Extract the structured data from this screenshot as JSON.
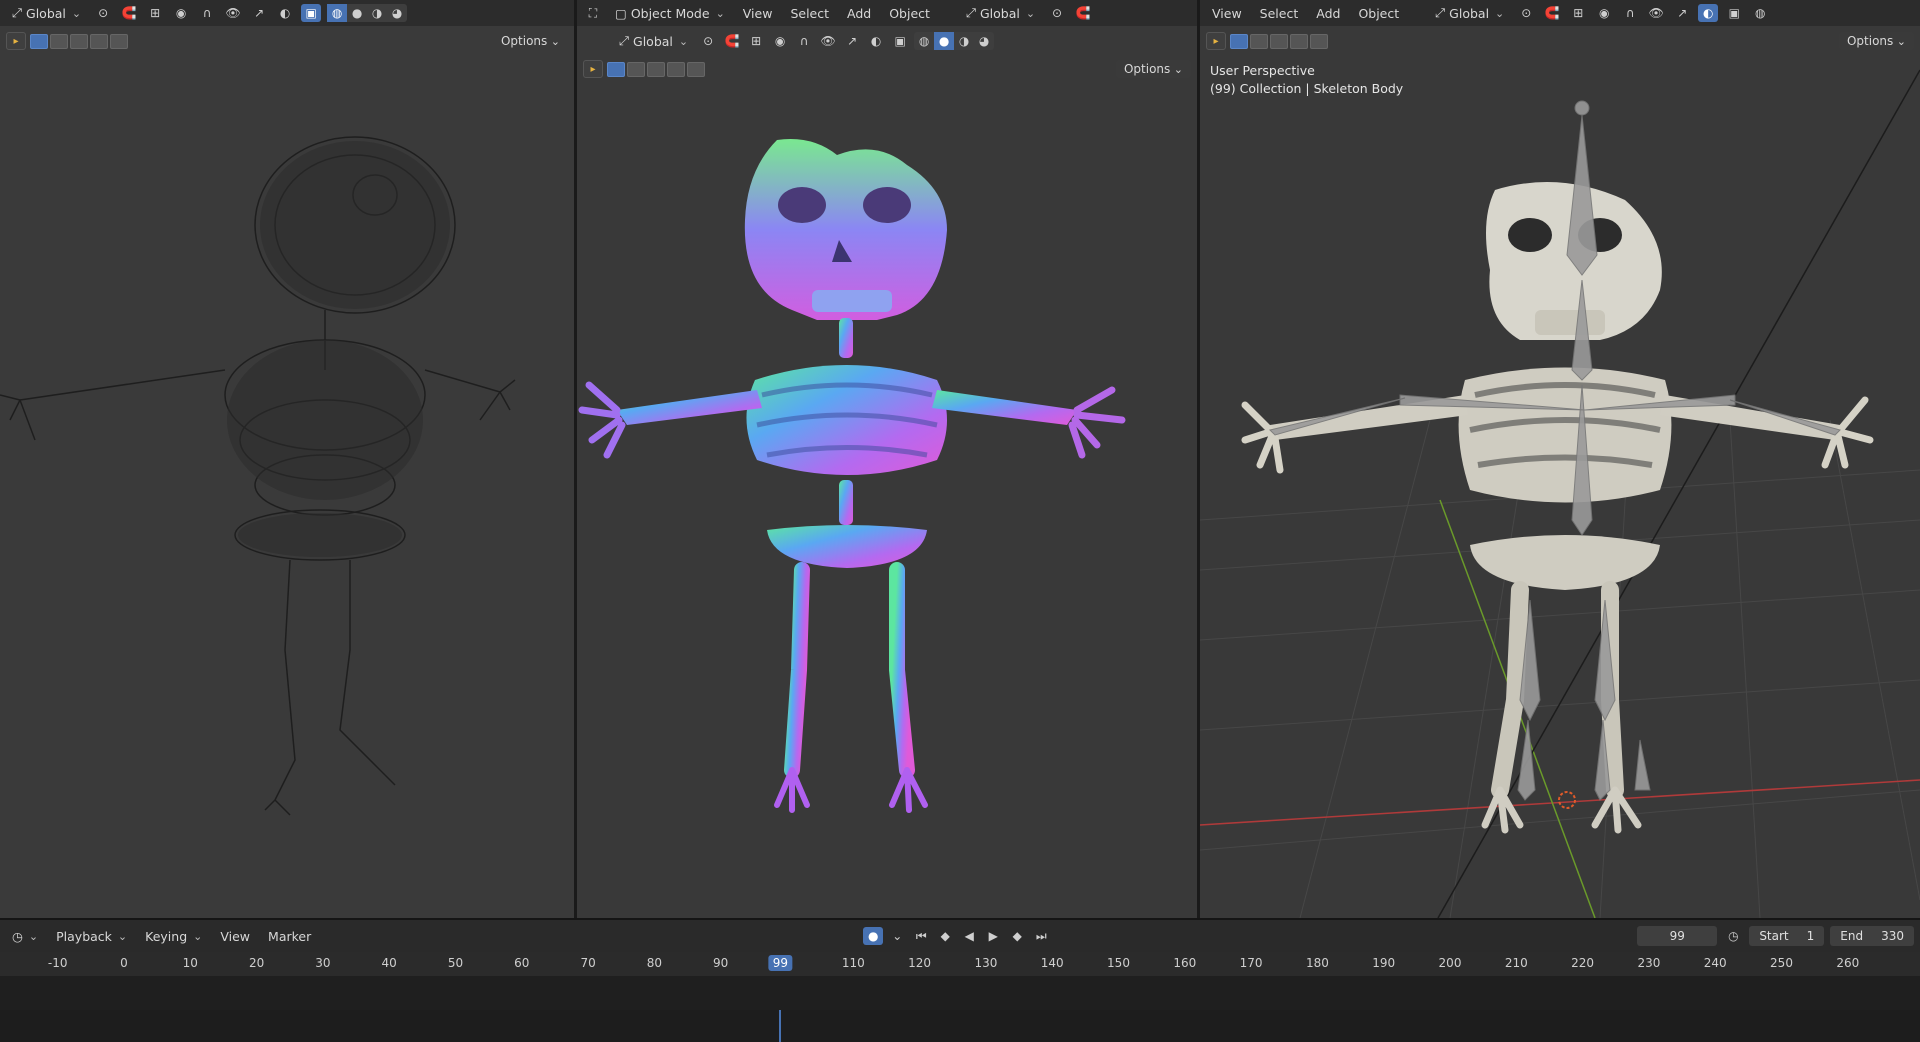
{
  "viewport_left": {
    "header": {
      "orientation": "Global",
      "options": "Options"
    }
  },
  "viewport_mid": {
    "header": {
      "mode": "Object Mode",
      "menu": [
        "View",
        "Select",
        "Add",
        "Object"
      ],
      "orientation": "Global"
    },
    "subheader": {
      "orientation": "Global",
      "options": "Options"
    }
  },
  "viewport_right": {
    "header": {
      "menu": [
        "View",
        "Select",
        "Add",
        "Object"
      ],
      "orientation": "Global",
      "options": "Options"
    },
    "overlay": {
      "perspective": "User Perspective",
      "collection": "(99) Collection | Skeleton Body"
    }
  },
  "timeline": {
    "menu": [
      "Playback",
      "Keying",
      "View",
      "Marker"
    ],
    "current_frame": "99",
    "start_label": "Start",
    "start_value": "1",
    "end_label": "End",
    "end_value": "330",
    "ticks": [
      "-10",
      "0",
      "10",
      "20",
      "30",
      "40",
      "50",
      "60",
      "70",
      "80",
      "90",
      "110",
      "120",
      "130",
      "140",
      "150",
      "160",
      "170",
      "180",
      "190",
      "200",
      "210",
      "220",
      "230",
      "240",
      "250",
      "260"
    ]
  },
  "icons": {
    "record": "record-icon",
    "jump_start": "jump-start-icon",
    "prev_key": "prev-keyframe-icon",
    "play_reverse": "play-reverse-icon",
    "play": "play-icon",
    "next_key": "next-keyframe-icon",
    "jump_end": "jump-end-icon"
  },
  "colors": {
    "accent": "#4772b3",
    "x_axis": "#b03a3a",
    "y_axis": "#6a9a2a"
  }
}
